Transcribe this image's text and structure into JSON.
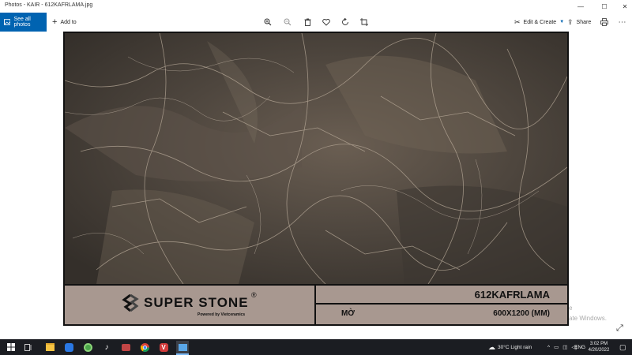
{
  "window": {
    "title": "Photos - KAIR - 612KAFRLAMA.jpg",
    "minimize_glyph": "—",
    "maximize_glyph": "☐",
    "close_glyph": "✕"
  },
  "toolbar": {
    "see_all_label": "See all photos",
    "add_to_label": "Add to",
    "edit_create_label": "Edit & Create",
    "share_label": "Share",
    "icons": [
      "zoom-in-icon",
      "zoom-out-icon",
      "delete-icon",
      "heart-icon",
      "rotate-icon",
      "crop-icon",
      "print-icon",
      "more-icon"
    ]
  },
  "image": {
    "brand_name": "SUPER STONE",
    "brand_reg": "®",
    "brand_sub": "Powered by Vietceramics",
    "product_code": "612KAFRLAMA",
    "finish": "MỜ",
    "size": "600X1200 (MM)",
    "colors": {
      "panel": "#a89890",
      "marble_base": "#4e463e"
    }
  },
  "watermark": {
    "line1": "e",
    "line2": "ate Windows."
  },
  "taskbar": {
    "weather": "30°C  Light rain",
    "language": "ENG",
    "time": "3:02 PM",
    "date": "4/20/2022"
  }
}
